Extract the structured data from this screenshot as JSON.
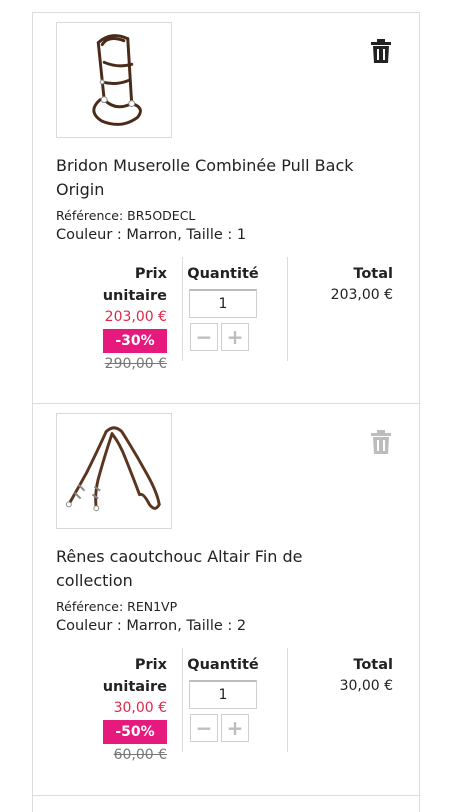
{
  "items": [
    {
      "name": "Bridon Muserolle Combinée Pull Back Origin",
      "reference": "Référence: BR5ODECL",
      "attributes": "Couleur : Marron, Taille : 1",
      "unit_label_1": "Prix",
      "unit_label_2": "unitaire",
      "price_now": "203,00 €",
      "discount": "-30%",
      "price_old": "290,00 €",
      "qty_label": "Quantité",
      "qty_value": "1",
      "total_label": "Total",
      "total_value": "203,00 €",
      "image_icon": "bridle-icon",
      "delete_icon": "trash-icon"
    },
    {
      "name": "Rênes caoutchouc Altair Fin de collection",
      "reference": "Référence: REN1VP",
      "attributes": "Couleur : Marron, Taille : 2",
      "unit_label_1": "Prix",
      "unit_label_2": "unitaire",
      "price_now": "30,00 €",
      "discount": "-50%",
      "price_old": "60,00 €",
      "qty_label": "Quantité",
      "qty_value": "1",
      "total_label": "Total",
      "total_value": "30,00 €",
      "image_icon": "reins-icon",
      "delete_icon": "trash-icon"
    }
  ],
  "stepper": {
    "minus": "−",
    "plus": "+"
  },
  "colors": {
    "price_now": "#e0284a",
    "discount_bg": "#e6197d",
    "trash_active": "#222222",
    "trash_disabled": "#bdbdbd",
    "leather": "#4a2a18"
  }
}
